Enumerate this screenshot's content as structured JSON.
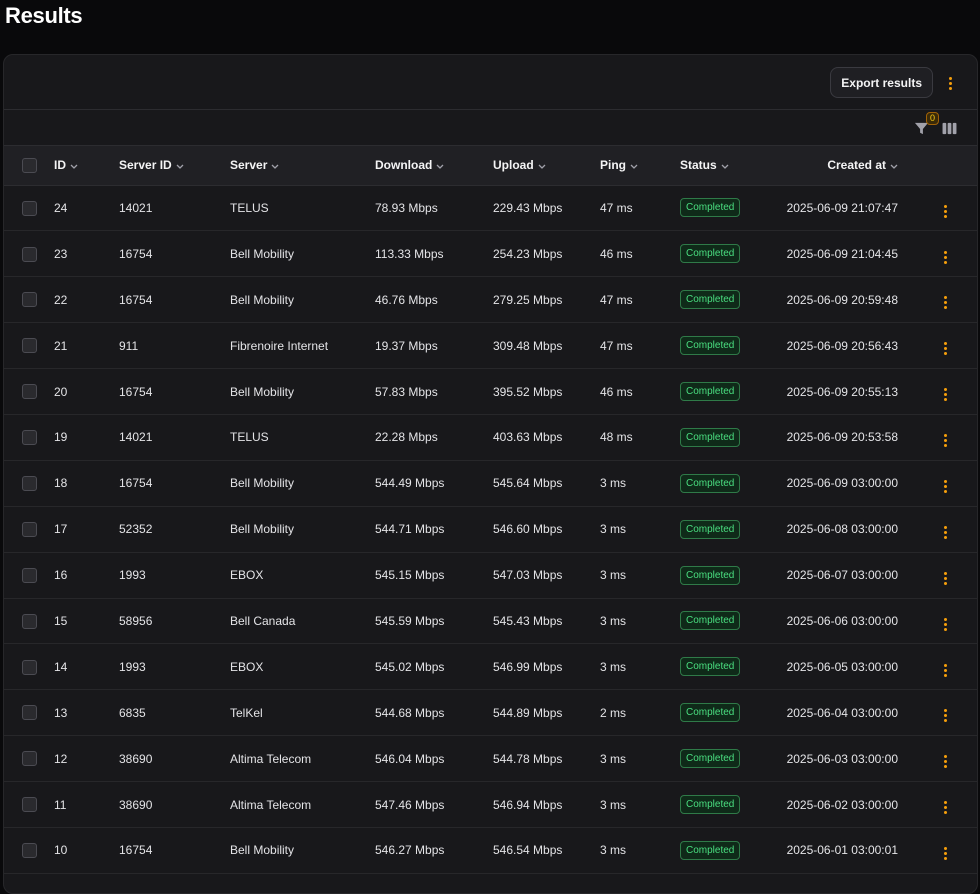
{
  "page": {
    "title": "Results"
  },
  "header": {
    "export_label": "Export results"
  },
  "toolbar": {
    "filter_count": "0"
  },
  "table": {
    "columns": {
      "id": "ID",
      "server_id": "Server ID",
      "server": "Server",
      "download": "Download",
      "upload": "Upload",
      "ping": "Ping",
      "status": "Status",
      "created_at": "Created at"
    },
    "rows": [
      {
        "id": "24",
        "server_id": "14021",
        "server": "TELUS",
        "download": "78.93 Mbps",
        "upload": "229.43 Mbps",
        "ping": "47 ms",
        "status": "Completed",
        "created_at": "2025-06-09 21:07:47"
      },
      {
        "id": "23",
        "server_id": "16754",
        "server": "Bell Mobility",
        "download": "113.33 Mbps",
        "upload": "254.23 Mbps",
        "ping": "46 ms",
        "status": "Completed",
        "created_at": "2025-06-09 21:04:45"
      },
      {
        "id": "22",
        "server_id": "16754",
        "server": "Bell Mobility",
        "download": "46.76 Mbps",
        "upload": "279.25 Mbps",
        "ping": "47 ms",
        "status": "Completed",
        "created_at": "2025-06-09 20:59:48"
      },
      {
        "id": "21",
        "server_id": "911",
        "server": "Fibrenoire Internet",
        "download": "19.37 Mbps",
        "upload": "309.48 Mbps",
        "ping": "47 ms",
        "status": "Completed",
        "created_at": "2025-06-09 20:56:43"
      },
      {
        "id": "20",
        "server_id": "16754",
        "server": "Bell Mobility",
        "download": "57.83 Mbps",
        "upload": "395.52 Mbps",
        "ping": "46 ms",
        "status": "Completed",
        "created_at": "2025-06-09 20:55:13"
      },
      {
        "id": "19",
        "server_id": "14021",
        "server": "TELUS",
        "download": "22.28 Mbps",
        "upload": "403.63 Mbps",
        "ping": "48 ms",
        "status": "Completed",
        "created_at": "2025-06-09 20:53:58"
      },
      {
        "id": "18",
        "server_id": "16754",
        "server": "Bell Mobility",
        "download": "544.49 Mbps",
        "upload": "545.64 Mbps",
        "ping": "3 ms",
        "status": "Completed",
        "created_at": "2025-06-09 03:00:00"
      },
      {
        "id": "17",
        "server_id": "52352",
        "server": "Bell Mobility",
        "download": "544.71 Mbps",
        "upload": "546.60 Mbps",
        "ping": "3 ms",
        "status": "Completed",
        "created_at": "2025-06-08 03:00:00"
      },
      {
        "id": "16",
        "server_id": "1993",
        "server": "EBOX",
        "download": "545.15 Mbps",
        "upload": "547.03 Mbps",
        "ping": "3 ms",
        "status": "Completed",
        "created_at": "2025-06-07 03:00:00"
      },
      {
        "id": "15",
        "server_id": "58956",
        "server": "Bell Canada",
        "download": "545.59 Mbps",
        "upload": "545.43 Mbps",
        "ping": "3 ms",
        "status": "Completed",
        "created_at": "2025-06-06 03:00:00"
      },
      {
        "id": "14",
        "server_id": "1993",
        "server": "EBOX",
        "download": "545.02 Mbps",
        "upload": "546.99 Mbps",
        "ping": "3 ms",
        "status": "Completed",
        "created_at": "2025-06-05 03:00:00"
      },
      {
        "id": "13",
        "server_id": "6835",
        "server": "TelKel",
        "download": "544.68 Mbps",
        "upload": "544.89 Mbps",
        "ping": "2 ms",
        "status": "Completed",
        "created_at": "2025-06-04 03:00:00"
      },
      {
        "id": "12",
        "server_id": "38690",
        "server": "Altima Telecom",
        "download": "546.04 Mbps",
        "upload": "544.78 Mbps",
        "ping": "3 ms",
        "status": "Completed",
        "created_at": "2025-06-03 03:00:00"
      },
      {
        "id": "11",
        "server_id": "38690",
        "server": "Altima Telecom",
        "download": "547.46 Mbps",
        "upload": "546.94 Mbps",
        "ping": "3 ms",
        "status": "Completed",
        "created_at": "2025-06-02 03:00:00"
      },
      {
        "id": "10",
        "server_id": "16754",
        "server": "Bell Mobility",
        "download": "546.27 Mbps",
        "upload": "546.54 Mbps",
        "ping": "3 ms",
        "status": "Completed",
        "created_at": "2025-06-01 03:00:01"
      }
    ]
  },
  "colors": {
    "accent": "#f59e0b",
    "status_completed": "#4ade80",
    "panel_bg": "#18181b",
    "page_bg": "#09090b"
  },
  "icons": {
    "filter": "filter-icon",
    "columns": "columns-icon",
    "more": "more-vertical-icon",
    "sort": "chevron-down-icon"
  }
}
